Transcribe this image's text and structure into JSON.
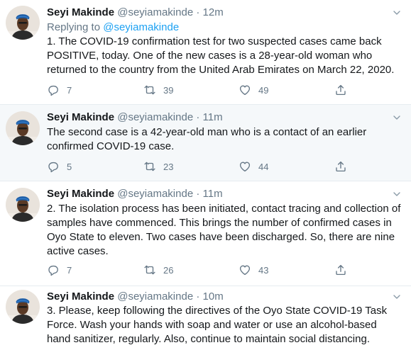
{
  "tweets": [
    {
      "name": "Seyi Makinde",
      "handle": "@seyiamakinde",
      "separator": "·",
      "time": "12m",
      "replying_prefix": "Replying to",
      "replying_to": "@seyiamakinde",
      "text": "1. The COVID-19 confirmation test for two suspected cases came back POSITIVE, today. One of the new cases is a 28-year-old woman who returned to the country from the United Arab Emirates on March 22, 2020.",
      "replies": "7",
      "retweets": "39",
      "likes": "49"
    },
    {
      "name": "Seyi Makinde",
      "handle": "@seyiamakinde",
      "separator": "·",
      "time": "11m",
      "text": "The second case is a 42-year-old man who is a contact of an earlier confirmed COVID-19 case.",
      "replies": "5",
      "retweets": "23",
      "likes": "44"
    },
    {
      "name": "Seyi Makinde",
      "handle": "@seyiamakinde",
      "separator": "·",
      "time": "11m",
      "text": "2. The isolation process has been initiated, contact tracing and collection of samples have commenced. This brings the number of confirmed cases in Oyo State to eleven. Two cases have been discharged. So, there are nine active cases.",
      "replies": "7",
      "retweets": "26",
      "likes": "43"
    },
    {
      "name": "Seyi Makinde",
      "handle": "@seyiamakinde",
      "separator": "·",
      "time": "10m",
      "text": "3. Please, keep following the directives of the Oyo State COVID-19 Task Force. Wash your hands with soap and water or use an alcohol-based hand sanitizer, regularly. Also, continue to maintain social distancing."
    }
  ],
  "icons": {
    "reply": "reply-icon",
    "retweet": "retweet-icon",
    "like": "heart-icon",
    "share": "share-icon",
    "caret": "chevron-down-icon"
  },
  "colors": {
    "link": "#1da1f2",
    "secondary_text": "#657786",
    "alt_background": "#f5f8fa"
  }
}
